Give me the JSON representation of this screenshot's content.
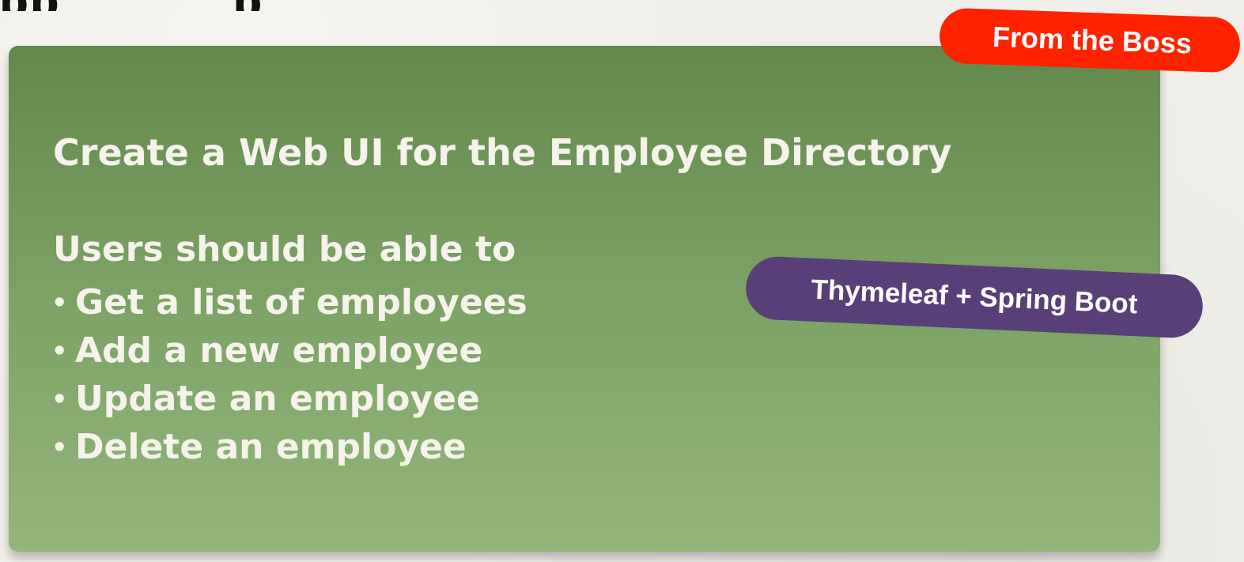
{
  "card": {
    "heading": "Create a Web UI for the Employee Directory",
    "intro": "Users should be able to",
    "bullets": [
      "Get a list of employees",
      "Add a new employee",
      "Update an employee",
      "Delete an employee"
    ]
  },
  "badges": {
    "from_boss": "From the Boss",
    "stack": "Thymeleaf + Spring Boot"
  },
  "colors": {
    "card_top": "#62884d",
    "card_bottom": "#93b67b",
    "boss_badge": "#ff2200",
    "stack_badge": "#593f78",
    "text": "#f5f3ea"
  }
}
